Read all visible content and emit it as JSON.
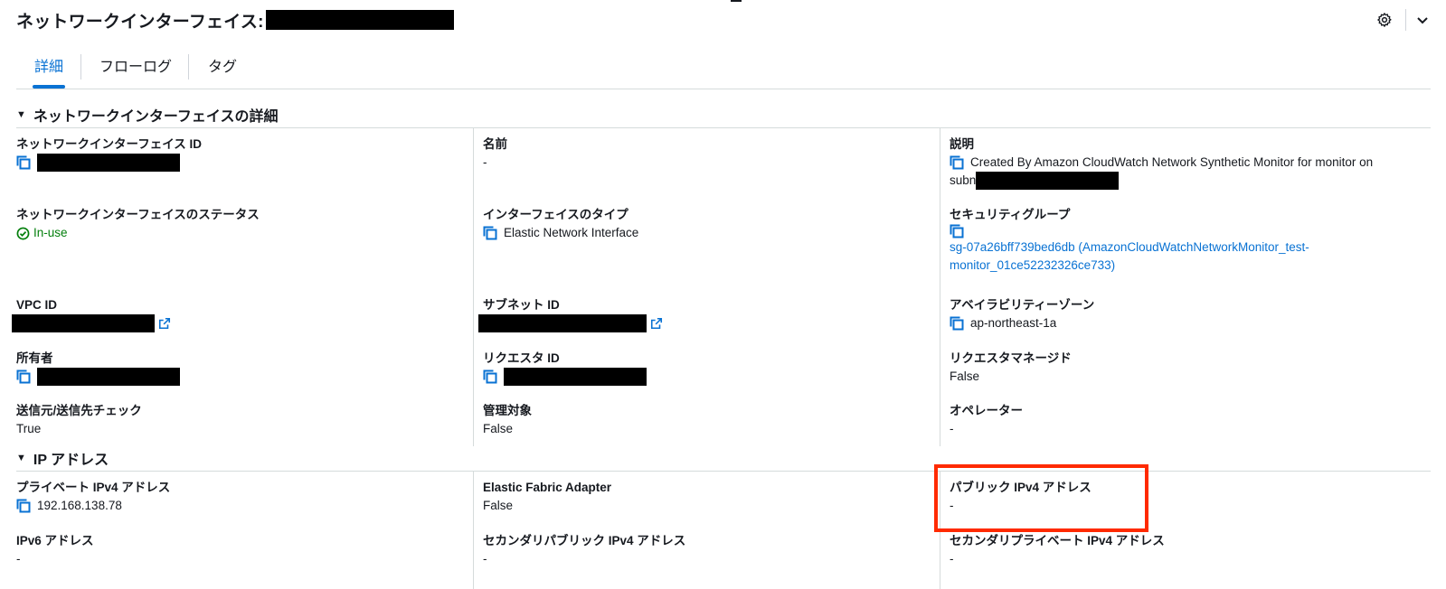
{
  "header": {
    "title": "ネットワークインターフェイス:"
  },
  "tabs": [
    {
      "label": "詳細",
      "active": true
    },
    {
      "label": "フローログ",
      "active": false
    },
    {
      "label": "タグ",
      "active": false
    }
  ],
  "sections": {
    "details": {
      "title": "ネットワークインターフェイスの詳細",
      "eni_id": {
        "label": "ネットワークインターフェイス ID"
      },
      "name": {
        "label": "名前",
        "value": "-"
      },
      "description": {
        "label": "説明",
        "value_line1": "Created By Amazon CloudWatch Network Synthetic Monitor for monitor on",
        "value_line2_prefix": "subn"
      },
      "status": {
        "label": "ネットワークインターフェイスのステータス",
        "value": "In-use"
      },
      "interface_type": {
        "label": "インターフェイスのタイプ",
        "value": "Elastic Network Interface"
      },
      "security_group": {
        "label": "セキュリティグループ",
        "value_line1": "sg-07a26bff739bed6db (AmazonCloudWatchNetworkMonitor_test-",
        "value_line2": "monitor_01ce52232326ce733)"
      },
      "vpc_id": {
        "label": "VPC ID"
      },
      "subnet_id": {
        "label": "サブネット ID"
      },
      "az": {
        "label": "アベイラビリティーゾーン",
        "value": "ap-northeast-1a"
      },
      "owner": {
        "label": "所有者"
      },
      "requester_id": {
        "label": "リクエスタ ID"
      },
      "requester_managed": {
        "label": "リクエスタマネージド",
        "value": "False"
      },
      "source_dest_check": {
        "label": "送信元/送信先チェック",
        "value": "True"
      },
      "managed": {
        "label": "管理対象",
        "value": "False"
      },
      "operator": {
        "label": "オペレーター",
        "value": "-"
      }
    },
    "ip": {
      "title": "IP アドレス",
      "private_ipv4": {
        "label": "プライベート IPv4 アドレス",
        "value": "192.168.138.78"
      },
      "efa": {
        "label": "Elastic Fabric Adapter",
        "value": "False"
      },
      "public_ipv4": {
        "label": "パブリック IPv4 アドレス",
        "value": "-"
      },
      "ipv6": {
        "label": "IPv6 アドレス",
        "value": "-"
      },
      "secondary_public_ipv4": {
        "label": "セカンダリパブリック IPv4 アドレス",
        "value": "-"
      },
      "secondary_private_ipv4": {
        "label": "セカンダリプライベート IPv4 アドレス",
        "value": "-"
      }
    }
  },
  "colors": {
    "accent": "#0972d3",
    "success": "#037f0c",
    "highlight": "#ff2a00"
  },
  "icons": [
    "copy-icon",
    "external-link-icon",
    "gear-icon",
    "chevron-down-icon",
    "status-check-icon",
    "caret-down-icon"
  ]
}
